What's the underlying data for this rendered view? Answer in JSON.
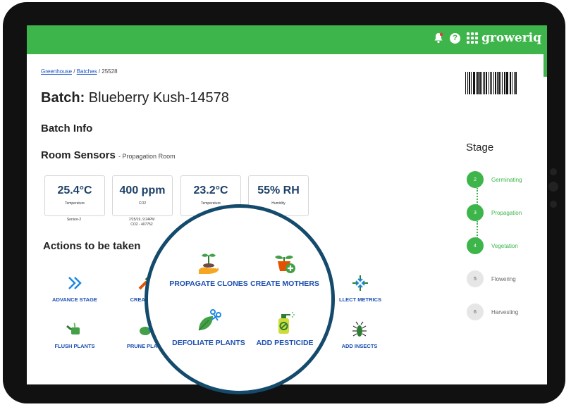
{
  "header": {
    "logo_text": "groweriq",
    "help_label": "?",
    "bell_icon": "bell-icon"
  },
  "breadcrumb": {
    "greenhouse": "Greenhouse",
    "batches": "Batches",
    "sep": " / ",
    "current": "25528"
  },
  "page": {
    "title_prefix": "Batch:",
    "title_name": "Blueberry Kush-14578",
    "batch_info_heading": "Batch Info",
    "room_sensors_heading": "Room Sensors",
    "room_name": "- Propagation Room",
    "actions_heading": "Actions to be taken"
  },
  "sensors": [
    {
      "value": "25.4°C",
      "label": "Temperature",
      "sub1": "Sensor-2",
      "sub2": ""
    },
    {
      "value": "400 ppm",
      "label": "CO2",
      "sub1": "7/25/19, 9:24PM",
      "sub2": "CO2 - 407752"
    },
    {
      "value": "23.2°C",
      "label": "Temperature",
      "sub1": "",
      "sub2": ""
    },
    {
      "value": "55% RH",
      "label": "Humidity",
      "sub1": "",
      "sub2": ""
    }
  ],
  "actions": {
    "advance_stage": "ADVANCE STAGE",
    "create_samples": "CREATE SA",
    "collect_metrics": "LLECT METRICS",
    "flush_plants": "FLUSH PLANTS",
    "prune_plants": "PRUNE PLANTS",
    "add_insects": "ADD INSECTS"
  },
  "magnified": {
    "propagate_clones": "PROPAGATE CLONES",
    "create_mothers": "CREATE MOTHERS",
    "defoliate_plants": "DEFOLIATE PLANTS",
    "add_pesticide": "ADD PESTICIDE"
  },
  "stage": {
    "heading": "Stage",
    "steps": [
      {
        "num": "2",
        "label": "Germinating",
        "active": true
      },
      {
        "num": "3",
        "label": "Propagation",
        "active": true
      },
      {
        "num": "4",
        "label": "Vegetation",
        "active": true
      },
      {
        "num": "5",
        "label": "Flowering",
        "active": false
      },
      {
        "num": "6",
        "label": "Harvesting",
        "active": false
      }
    ]
  },
  "colors": {
    "brand_green": "#3db54a",
    "navy": "#1d4068",
    "link_blue": "#1d4fb0",
    "ring": "#144a6b"
  }
}
